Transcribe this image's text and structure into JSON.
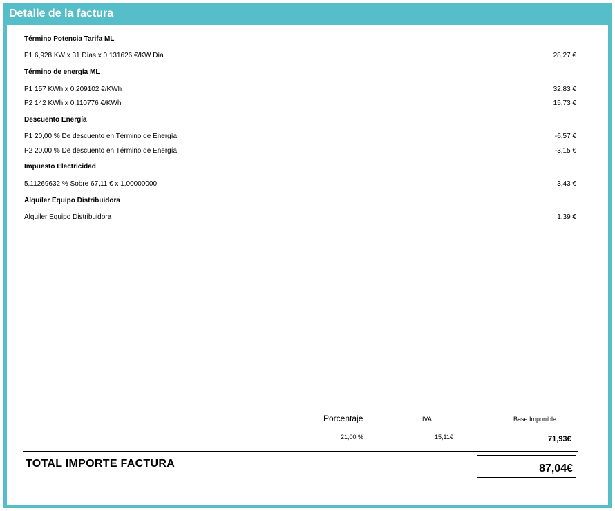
{
  "header": {
    "title": "Detalle de la factura"
  },
  "sections": [
    {
      "title": "Término Potencia Tarifa ML",
      "items": [
        {
          "desc": "P1 6,928 KW x 31 Días x 0,131626 €/KW Día",
          "amount": "28,27 €"
        }
      ]
    },
    {
      "title": "Término de energía ML",
      "items": [
        {
          "desc": "P1 157 KWh x 0,209102 €/KWh",
          "amount": "32,83 €"
        },
        {
          "desc": "P2 142 KWh x 0,110776 €/KWh",
          "amount": "15,73 €"
        }
      ]
    },
    {
      "title": "Descuento Energía",
      "items": [
        {
          "desc": "P1 20,00 % De descuento en Término de Energía",
          "amount": "-6,57 €"
        },
        {
          "desc": "P2 20,00 % De descuento en Término de Energía",
          "amount": "-3,15 €"
        }
      ]
    },
    {
      "title": "Impuesto Electricidad",
      "items": [
        {
          "desc": "5,11269632 % Sobre 67,11 € x 1,00000000",
          "amount": "3,43 €"
        }
      ]
    },
    {
      "title": "Alquiler Equipo Distribuidora",
      "items": [
        {
          "desc": "Alquiler Equipo Distribuidora",
          "amount": "1,39 €"
        }
      ]
    }
  ],
  "summary": {
    "headers": {
      "porcentaje": "Porcentaje",
      "iva": "IVA",
      "base": "Base Imponible"
    },
    "values": {
      "porcentaje": "21,00 %",
      "iva": "15,11€",
      "base": "71,93€"
    }
  },
  "total": {
    "label": "TOTAL IMPORTE FACTURA",
    "value": "87,04€"
  },
  "colors": {
    "frame": "#55bec8"
  }
}
